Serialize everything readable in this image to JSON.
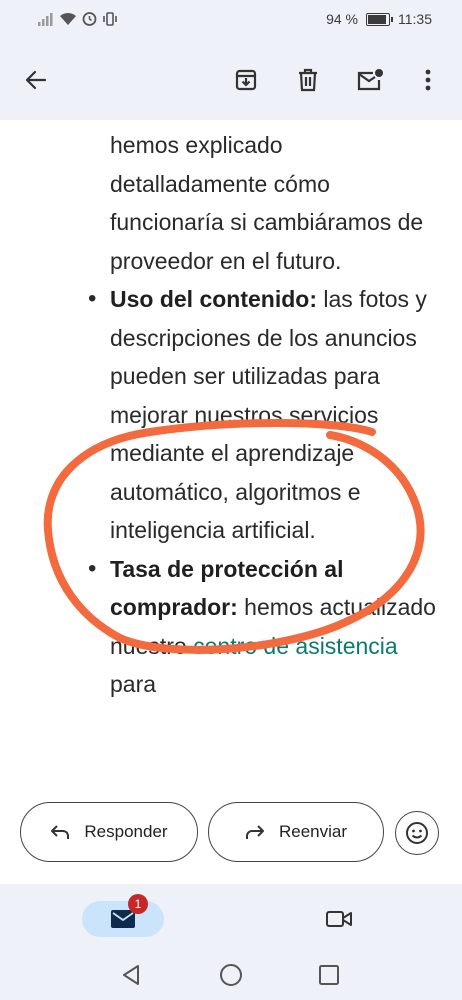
{
  "status_bar": {
    "battery_percent": "94 %",
    "time": "11:35"
  },
  "toolbar": {
    "back_icon": "arrow-left-icon",
    "archive_icon": "archive-icon",
    "delete_icon": "trash-icon",
    "mark_unread_icon": "mail-unread-icon",
    "more_icon": "more-vert-icon"
  },
  "content": {
    "para1": "hemos explicado detalladamente cómo funcionaría si cambiáramos de proveedor en el futuro.",
    "bullet2_title": "Uso del contenido:",
    "bullet2_text": " las fotos y descripciones de los anuncios pueden ser utilizadas para mejorar nuestros servicios mediante el aprendizaje automático, algoritmos e inteligencia artificial.",
    "bullet3_title": "Tasa de protección al comprador:",
    "bullet3_text": " hemos actualizado nuestro ",
    "bullet3_link": "centro de asistencia",
    "bullet3_after": " para",
    "annotation_color": "#f26a3d"
  },
  "actions": {
    "reply_label": "Responder",
    "forward_label": "Reenviar"
  },
  "bottom_nav": {
    "mail_badge": "1"
  }
}
